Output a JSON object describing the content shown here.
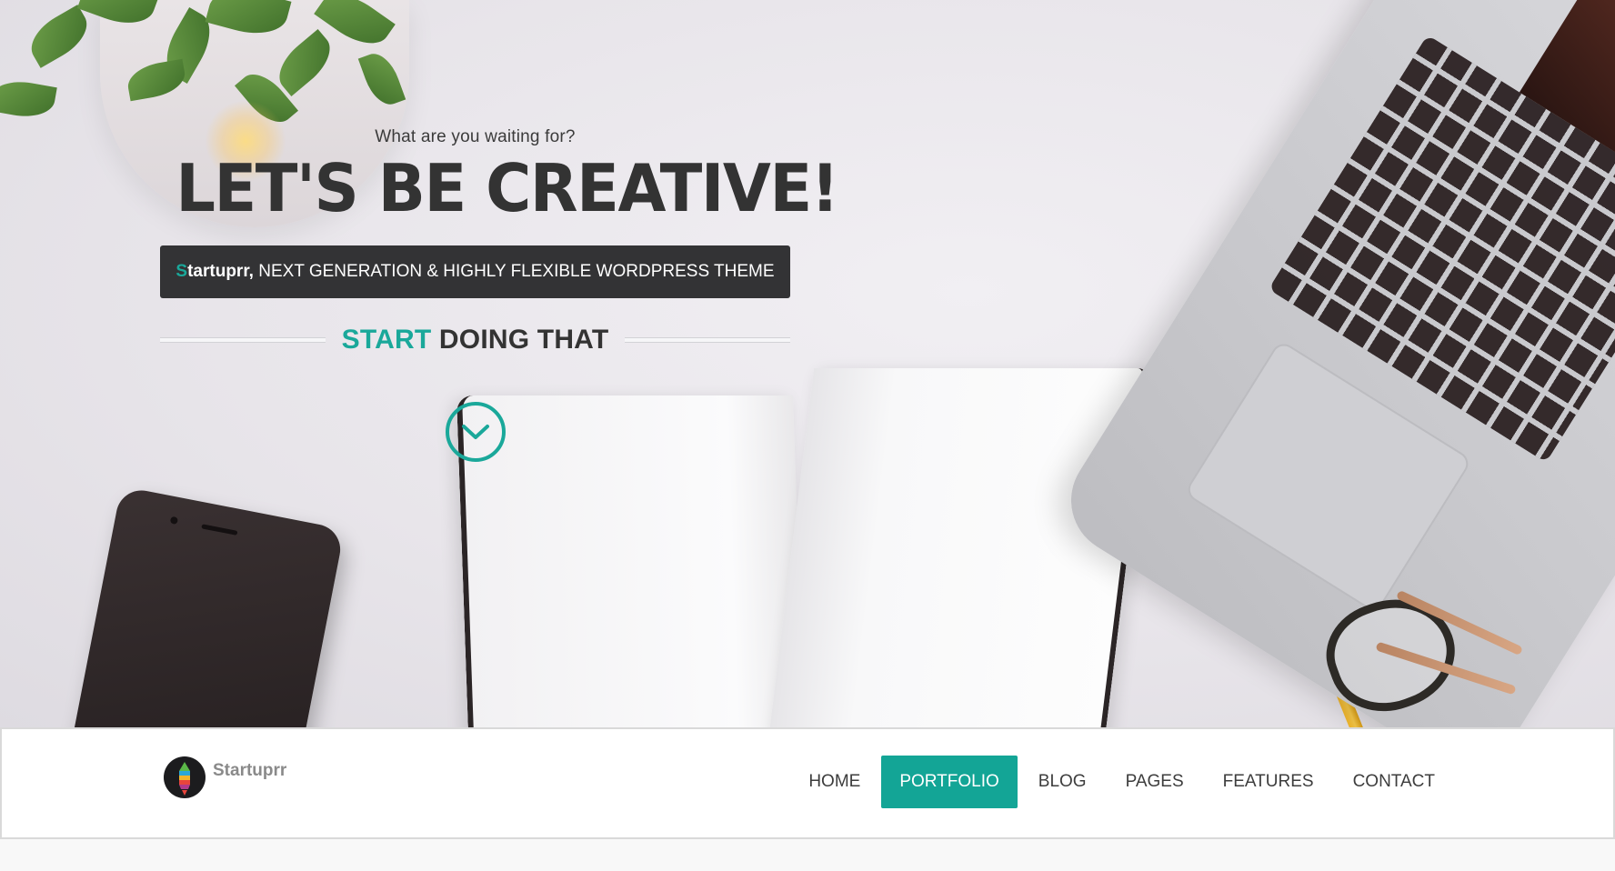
{
  "hero": {
    "kicker": "What are you waiting for?",
    "headline": "LET'S BE CREATIVE!",
    "tagline": {
      "brand_first_letter": "S",
      "brand_rest": "tartuprr,",
      "text": " NEXT GENERATION & HIGHLY FLEXIBLE WORDPRESS THEME"
    },
    "cta": {
      "accent": "START",
      "rest": " DOING THAT"
    },
    "scroll_icon": "chevron-down-circle-icon"
  },
  "navbar": {
    "logo_text": "Startuprr",
    "items": [
      {
        "label": "HOME",
        "active": false
      },
      {
        "label": "PORTFOLIO",
        "active": true
      },
      {
        "label": "BLOG",
        "active": false
      },
      {
        "label": "PAGES",
        "active": false
      },
      {
        "label": "FEATURES",
        "active": false
      },
      {
        "label": "CONTACT",
        "active": false
      }
    ]
  },
  "colors": {
    "accent": "#1aa89a",
    "dark": "#333333",
    "tagline_bg": "#333335",
    "nav_active_bg": "#13a596"
  }
}
